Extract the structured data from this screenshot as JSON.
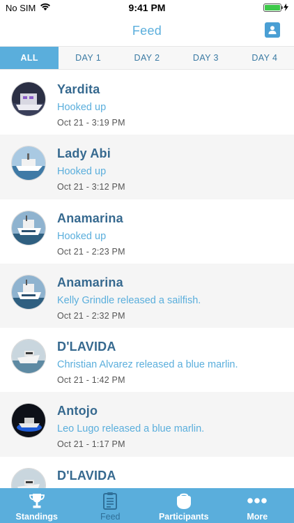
{
  "status_bar": {
    "carrier": "No SIM",
    "time": "9:41 PM",
    "battery_color": "#3dc94a"
  },
  "nav": {
    "title": "Feed",
    "profile_icon": "person-icon"
  },
  "day_tabs": [
    {
      "label": "ALL",
      "active": true
    },
    {
      "label": "DAY 1",
      "active": false
    },
    {
      "label": "DAY 2",
      "active": false
    },
    {
      "label": "DAY 3",
      "active": false
    },
    {
      "label": "DAY 4",
      "active": false
    }
  ],
  "feed": [
    {
      "boat": "Yardita",
      "event": "Hooked up",
      "time": "Oct 21 - 3:19 PM"
    },
    {
      "boat": "Lady Abi",
      "event": "Hooked up",
      "time": "Oct 21 - 3:12 PM"
    },
    {
      "boat": "Anamarina",
      "event": "Hooked up",
      "time": "Oct 21 - 2:23 PM"
    },
    {
      "boat": "Anamarina",
      "event": "Kelly  Grindle released a sailfish.",
      "time": "Oct 21 - 2:32 PM"
    },
    {
      "boat": "D'LAVIDA",
      "event": "Christian Alvarez released a blue marlin.",
      "time": "Oct 21 - 1:42 PM"
    },
    {
      "boat": "Antojo",
      "event": "Leo  Lugo released a blue marlin.",
      "time": "Oct 21 - 1:17 PM"
    },
    {
      "boat": "D'LAVIDA",
      "event": "",
      "time": ""
    }
  ],
  "bottom_tabs": [
    {
      "label": "Standings",
      "icon": "trophy-icon"
    },
    {
      "label": "Feed",
      "icon": "clipboard-icon",
      "active": true
    },
    {
      "label": "Participants",
      "icon": "boat-icon"
    },
    {
      "label": "More",
      "icon": "more-dots-icon"
    }
  ],
  "colors": {
    "accent": "#5aaedc",
    "boat_name": "#36698f",
    "active_tab_text": "#2f6f98"
  }
}
